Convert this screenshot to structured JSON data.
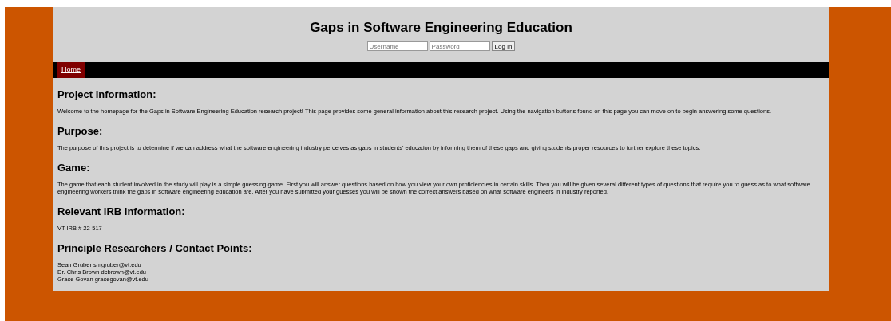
{
  "header": {
    "title": "Gaps in Software Engineering Education"
  },
  "login": {
    "username": {
      "placeholder": "Username"
    },
    "password": {
      "placeholder": "Password"
    },
    "button": "Log in"
  },
  "nav": [
    {
      "label": "Home",
      "selected": true
    }
  ],
  "sections": [
    {
      "heading": "Project Information:",
      "lines": [
        "Welcome to the homepage for the Gaps in Software Engineering Education research project! This page provides some general information about this research project. Using the navigation buttons found on this page you can move on to begin answering some questions."
      ]
    },
    {
      "heading": "Purpose:",
      "lines": [
        "The purpose of this project is to determine if we can address what the software engineering industry perceives as gaps in students' education by informing them of these gaps and giving students proper resources to further explore these topics."
      ]
    },
    {
      "heading": "Game:",
      "lines": [
        "The game that each student involved in the study will play is a simple guessing game. First you will answer questions based on how you view your own proficiencies in certain skills. Then you will be given several different types of questions that require you to guess as to what software engineering workers think the gaps in software engineering education are. After you have submitted your guesses you will be shown the correct answers based on what software engineers in industry reported."
      ]
    },
    {
      "heading": "Relevant IRB Information:",
      "lines": [
        "VT IRB # 22-517"
      ]
    },
    {
      "heading": "Principle Researchers / Contact Points:",
      "lines": [
        "Sean Gruber smgruber@vt.edu",
        "Dr. Chris Brown dcbrown@vt.edu",
        "Grace Govan gracegovan@vt.edu"
      ]
    }
  ]
}
